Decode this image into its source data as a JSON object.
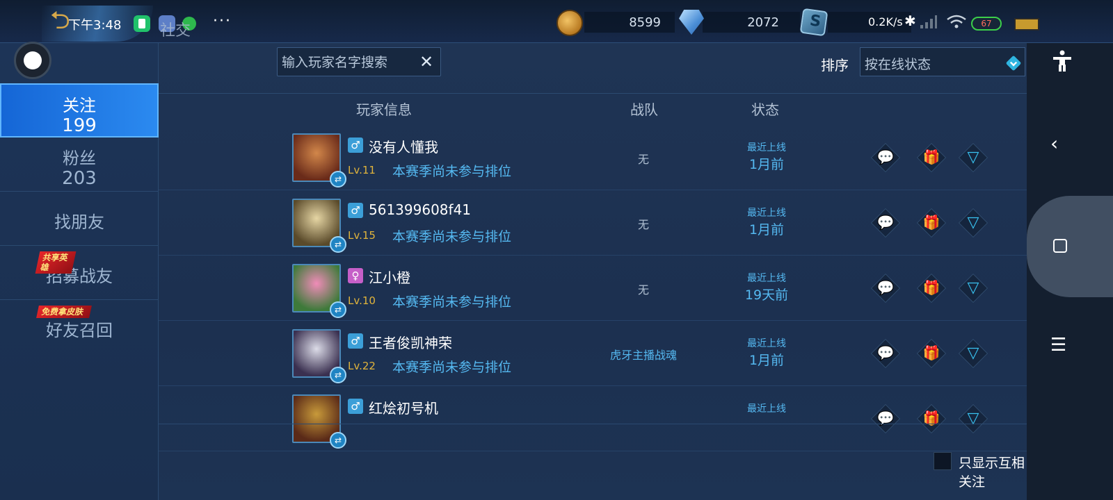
{
  "statusbar": {
    "time": "下午3:48",
    "more": "···",
    "net_speed": "0.2K/s",
    "battery": "67"
  },
  "page_title": "社交",
  "currency": {
    "gold": "8599",
    "diamond": "2072"
  },
  "nav": [
    {
      "label": "关注",
      "count": "199",
      "active": true
    },
    {
      "label": "粉丝",
      "count": "203"
    },
    {
      "label": "找朋友"
    },
    {
      "label": "招募战友",
      "badge": "共享英雄"
    },
    {
      "label": "好友召回",
      "badge": "免费拿皮肤"
    }
  ],
  "search": {
    "placeholder": "输入玩家名字搜索",
    "clear_icon": "close-icon"
  },
  "sort": {
    "label": "排序",
    "value": "按在线状态"
  },
  "columns": {
    "player": "玩家信息",
    "team": "战队",
    "status": "状态"
  },
  "players": [
    {
      "name": "没有人懂我",
      "gender": "male",
      "level": "Lv.11",
      "rank": "本赛季尚未参与排位",
      "team": "无",
      "status_label": "最近上线",
      "status_time": "1月前",
      "gift_disabled": true,
      "avatar_colors": [
        "#6a2b1a",
        "#d2874a"
      ]
    },
    {
      "name": "561399608f41",
      "gender": "male",
      "level": "Lv.15",
      "rank": "本赛季尚未参与排位",
      "team": "无",
      "status_label": "最近上线",
      "status_time": "1月前",
      "avatar_colors": [
        "#5a4a2a",
        "#e6d6a4"
      ]
    },
    {
      "name": "江小橙",
      "gender": "female",
      "level": "Lv.10",
      "rank": "本赛季尚未参与排位",
      "team": "无",
      "status_label": "最近上线",
      "status_time": "19天前",
      "avatar_colors": [
        "#3e7a3a",
        "#f08cb8"
      ]
    },
    {
      "name": "王者俊凯神荣",
      "gender": "male",
      "level": "Lv.22",
      "rank": "本赛季尚未参与排位",
      "team": "虎牙主播战魂",
      "status_label": "最近上线",
      "status_time": "1月前",
      "avatar_colors": [
        "#3a3050",
        "#dcdce8"
      ]
    },
    {
      "name": "红烩初号机",
      "gender": "male",
      "level": "",
      "rank": "",
      "team": "",
      "status_label": "最近上线",
      "status_time": "",
      "avatar_colors": [
        "#5a2a18",
        "#c89a3a"
      ]
    }
  ],
  "footer": {
    "mutual_only": "只显示互相关注",
    "checked": false
  }
}
